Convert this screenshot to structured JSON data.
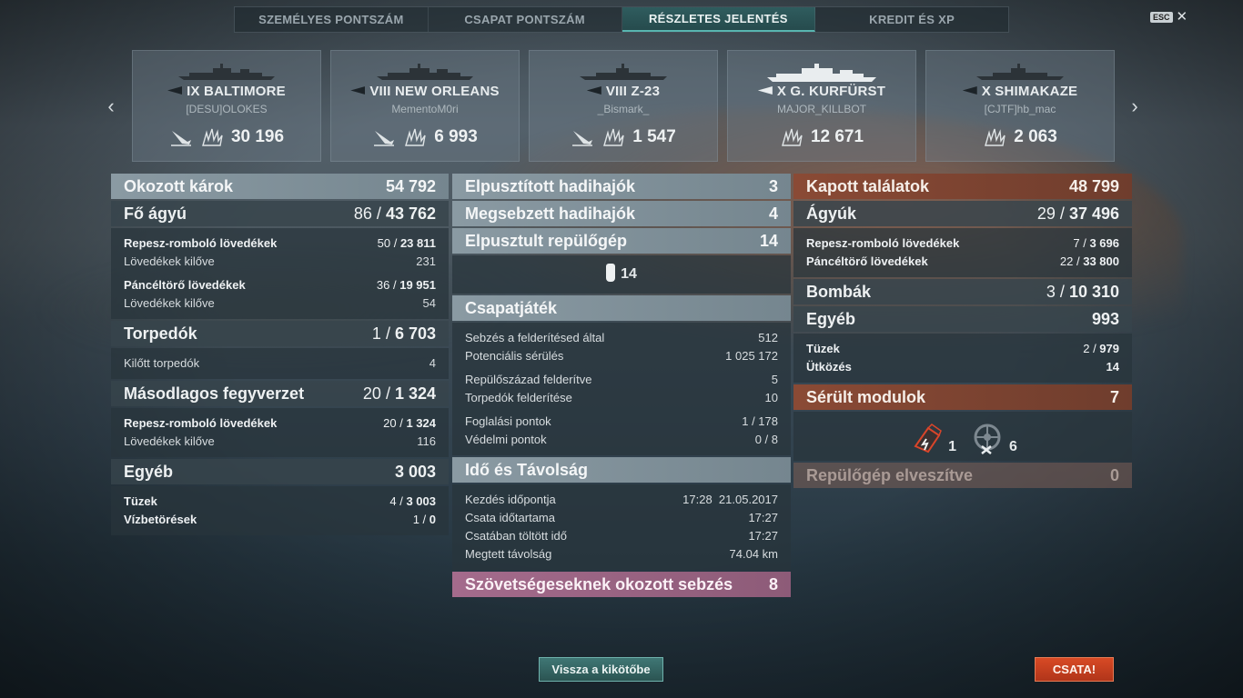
{
  "tabs": [
    {
      "label": "SZEMÉLYES PONTSZÁM"
    },
    {
      "label": "CSAPAT PONTSZÁM"
    },
    {
      "label": "RÉSZLETES JELENTÉS"
    },
    {
      "label": "KREDIT ÉS XP"
    }
  ],
  "esc": {
    "key": "ESC",
    "close": "✕"
  },
  "nav": {
    "prev": "‹",
    "next": "›"
  },
  "ships": [
    {
      "name": "IX BALTIMORE",
      "player": "[DESU]OLOKES",
      "damage": "30 196"
    },
    {
      "name": "VIII NEW ORLEANS",
      "player": "MementoM0ri",
      "damage": "6 993"
    },
    {
      "name": "VIII Z-23",
      "player": "_Bismark_",
      "damage": "1 547"
    },
    {
      "name": "X G. KURFÜRST",
      "player": "MAJOR_KILLBOT",
      "damage": "12 671"
    },
    {
      "name": "X SHIMAKAZE",
      "player": "[CJTF]hb_mac",
      "damage": "2 063"
    }
  ],
  "left": {
    "dealt": {
      "label": "Okozott károk",
      "value": "54 792"
    },
    "main": {
      "label": "Fő ágyú",
      "hits": "86",
      "sep": " / ",
      "value": "43 762"
    },
    "main_rows": [
      {
        "label": "Repesz-romboló lövedékek",
        "hits": "50",
        "value": "23 811"
      },
      {
        "label": "Lövedékek kilőve",
        "value": "231"
      },
      {
        "label": "Páncéltörő lövedékek",
        "hits": "36",
        "value": "19 951"
      },
      {
        "label": "Lövedékek kilőve",
        "value": "54"
      }
    ],
    "torp": {
      "label": "Torpedók",
      "hits": "1",
      "value": "6 703"
    },
    "torp_rows": [
      {
        "label": "Kilőtt torpedók",
        "value": "4"
      }
    ],
    "sec": {
      "label": "Másodlagos fegyverzet",
      "hits": "20",
      "value": "1 324"
    },
    "sec_rows": [
      {
        "label": "Repesz-romboló lövedékek",
        "hits": "20",
        "value": "1 324"
      },
      {
        "label": "Lövedékek kilőve",
        "value": "116"
      }
    ],
    "other": {
      "label": "Egyéb",
      "value": "3 003"
    },
    "other_rows": [
      {
        "label": "Tüzek",
        "hits": "4",
        "value": "3 003"
      },
      {
        "label": "Vízbetörések",
        "hits": "1",
        "value": "0"
      }
    ]
  },
  "middle": {
    "destroyed": {
      "label": "Elpusztított hadihajók",
      "value": "3"
    },
    "damaged": {
      "label": "Megsebzett hadihajók",
      "value": "4"
    },
    "planes": {
      "label": "Elpusztult repülőgép",
      "value": "14"
    },
    "planes_icon_value": "14",
    "team": {
      "label": "Csapatjáték"
    },
    "team_rows": [
      {
        "label": "Sebzés a felderítésed által",
        "value": "512"
      },
      {
        "label": "Potenciális sérülés",
        "value": "1 025 172"
      },
      {
        "label": "Repülőszázad felderítve",
        "value": "5"
      },
      {
        "label": "Torpedók felderítése",
        "value": "10"
      },
      {
        "label": "Foglalási pontok",
        "value": "1 / 178"
      },
      {
        "label": "Védelmi pontok",
        "value": "0 / 8"
      }
    ],
    "time": {
      "label": "Idő és Távolság"
    },
    "time_rows": [
      {
        "label": "Kezdés időpontja",
        "value": "17:28  21.05.2017"
      },
      {
        "label": "Csata időtartama",
        "value": "17:27"
      },
      {
        "label": "Csatában töltött idő",
        "value": "17:27"
      },
      {
        "label": "Megtett távolság",
        "value": "74.04 km"
      }
    ],
    "ally": {
      "label": "Szövetségeseknek okozott sebzés",
      "value": "8"
    }
  },
  "right": {
    "received": {
      "label": "Kapott találatok",
      "value": "48 799"
    },
    "guns": {
      "label": "Ágyúk",
      "hits": "29",
      "value": "37 496"
    },
    "guns_rows": [
      {
        "label": "Repesz-romboló lövedékek",
        "hits": "7",
        "value": "3 696"
      },
      {
        "label": "Páncéltörő lövedékek",
        "hits": "22",
        "value": "33 800"
      }
    ],
    "bombs": {
      "label": "Bombák",
      "hits": "3",
      "value": "10 310"
    },
    "other": {
      "label": "Egyéb",
      "value": "993"
    },
    "other_rows": [
      {
        "label": "Tüzek",
        "hits": "2",
        "value": "979"
      },
      {
        "label": "Ütközés",
        "value": "14"
      }
    ],
    "modules": {
      "label": "Sérült modulok",
      "value": "7"
    },
    "module_icons": [
      {
        "icon": "engine-damaged-icon",
        "value": "1"
      },
      {
        "icon": "steering-damaged-icon",
        "value": "6"
      }
    ],
    "planes_lost": {
      "label": "Repülőgép elveszítve",
      "value": "0"
    }
  },
  "buttons": {
    "back": "Vissza a kikötőbe",
    "battle": "CSATA!"
  },
  "colors": {
    "accent_teal": "#58b5b0",
    "battle_red": "#c8401f",
    "received_orange": "#8a4a35",
    "ally_pink": "#a46b8c"
  }
}
